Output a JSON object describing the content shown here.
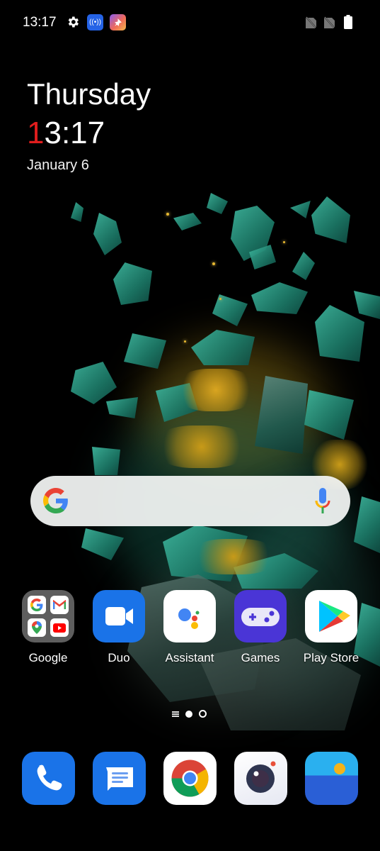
{
  "status_bar": {
    "time": "13:17",
    "icons": [
      "settings-icon",
      "hotspot-icon",
      "app-notification-icon",
      "no-sim-icon",
      "no-sim-icon",
      "battery-icon"
    ]
  },
  "clock_widget": {
    "day": "Thursday",
    "time_first_digit": "1",
    "time_rest": "3:17",
    "date": "January 6"
  },
  "search_widget": {
    "logo": "google-g-icon",
    "mic": "mic-icon"
  },
  "home_apps": [
    {
      "label": "Google",
      "icon": "google-folder-icon"
    },
    {
      "label": "Duo",
      "icon": "duo-icon"
    },
    {
      "label": "Assistant",
      "icon": "assistant-icon"
    },
    {
      "label": "Games",
      "icon": "games-icon"
    },
    {
      "label": "Play Store",
      "icon": "play-store-icon"
    }
  ],
  "page_indicator": {
    "pages": 2,
    "current": 1
  },
  "dock": [
    {
      "name": "Phone",
      "icon": "phone-icon"
    },
    {
      "name": "Messages",
      "icon": "messages-icon"
    },
    {
      "name": "Chrome",
      "icon": "chrome-icon"
    },
    {
      "name": "Camera",
      "icon": "camera-icon"
    },
    {
      "name": "Gallery",
      "icon": "gallery-icon"
    }
  ],
  "colors": {
    "accent_red": "#e01d1d",
    "duo_blue": "#1a73e8",
    "games_purple": "#4a35d6"
  }
}
